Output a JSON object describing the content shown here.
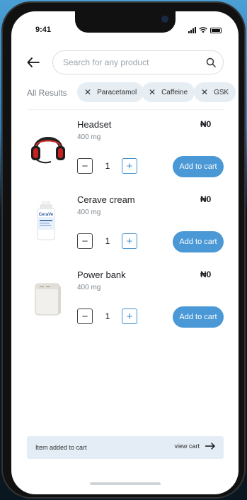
{
  "status_bar": {
    "time": "9:41"
  },
  "search": {
    "placeholder": "Search for any product"
  },
  "filters": {
    "all_results_label": "All Results",
    "chips": [
      {
        "label": "Paracetamol"
      },
      {
        "label": "Caffeine"
      },
      {
        "label": "GSK"
      }
    ]
  },
  "products": [
    {
      "name": "Headset",
      "dose": "400 mg",
      "price": "₦0",
      "quantity": "1",
      "add_label": "Add to cart"
    },
    {
      "name": "Cerave cream",
      "dose": "400 mg",
      "price": "₦0",
      "quantity": "1",
      "add_label": "Add to cart"
    },
    {
      "name": "Power bank",
      "dose": "400 mg",
      "price": "₦0",
      "quantity": "1",
      "add_label": "Add to cart"
    }
  ],
  "toast": {
    "message": "Item added to cart",
    "link_label": "view cart"
  },
  "colors": {
    "accent": "#4a98d6",
    "chip_bg": "#e6edf3",
    "toast_bg": "#e4edf5"
  },
  "icons": {
    "back": "back-arrow-icon",
    "search": "search-icon",
    "chip_remove": "close-icon",
    "toast_link": "arrow-right-icon"
  }
}
